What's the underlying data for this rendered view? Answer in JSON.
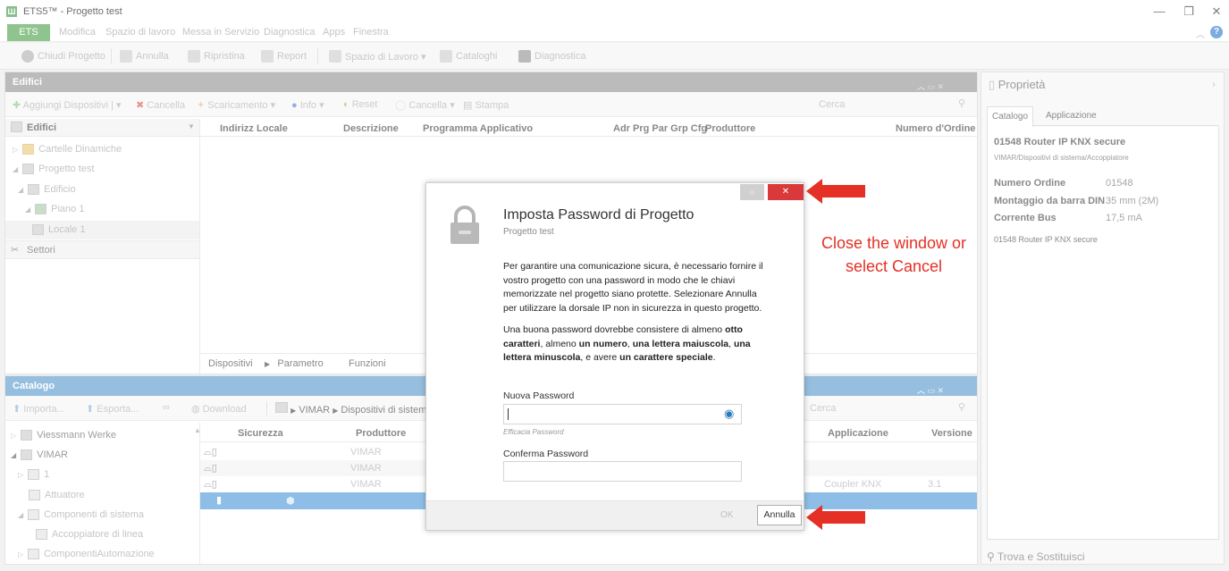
{
  "window": {
    "title": "ETS5™ - Progetto test",
    "controls": [
      "—",
      "❐",
      "✕"
    ]
  },
  "menubar": {
    "ets": "ETS",
    "items": [
      "Modifica",
      "Spazio di lavoro",
      "Messa in Servizio",
      "Diagnostica",
      "Apps",
      "Finestra"
    ]
  },
  "toolbar": {
    "items": [
      "Chiudi Progetto",
      "Annulla",
      "Ripristina",
      "Report",
      "Spazio di Lavoro ▾",
      "Cataloghi",
      "Diagnostica"
    ]
  },
  "buildings_panel": {
    "title": "Edifici",
    "subtoolbar": [
      "Aggiungi Dispositivi | ▾",
      "Cancella",
      "Scaricamento ▾",
      "Info ▾",
      "Reset",
      "Cancella ▾",
      "Stampa"
    ],
    "search_placeholder": "Cerca",
    "tree_header": "Edifici",
    "tree": [
      "Cartelle Dinamiche",
      "Progetto test",
      "Edificio",
      "Piano 1",
      "Locale 1",
      "Settori"
    ],
    "columns": [
      "Indirizz",
      "Locale",
      "Descrizione",
      "Programma Applicativo",
      "Adr Prg Par Grp Cfg",
      "Produttore",
      "Numero d'Ordine"
    ],
    "tabs": [
      "Dispositivi",
      "Parametro",
      "Funzioni"
    ]
  },
  "catalog_panel": {
    "title": "Catalogo",
    "subtoolbar": [
      "Importa...",
      "Esporta...",
      "Download"
    ],
    "breadcrumb": [
      "VIMAR",
      "Dispositivi di sistema"
    ],
    "search_placeholder": "Cerca",
    "tree": [
      "Viessmann Werke",
      "VIMAR",
      "1",
      "Attuatore",
      "Componenti di sistema",
      "Accoppiatore di linea",
      "ComponentiAutomazione"
    ],
    "columns": [
      "Sicurezza",
      "Produttore",
      "Applicazione",
      "Versione"
    ],
    "rows": [
      {
        "producer": "VIMAR",
        "application": "",
        "version": ""
      },
      {
        "producer": "VIMAR",
        "application": "",
        "version": ""
      },
      {
        "producer": "VIMAR",
        "application": "Coupler KNX",
        "version": "3.1"
      },
      {
        "producer": "",
        "application": "",
        "version": ""
      }
    ]
  },
  "properties_panel": {
    "title": "Proprietà",
    "tabs": [
      "Catalogo",
      "Applicazione"
    ],
    "product_title": "01548 Router IP KNX secure",
    "product_path": "VIMAR/Dispositivi di sistema/Accoppiatore",
    "fields": [
      {
        "label": "Numero Ordine",
        "value": "01548"
      },
      {
        "label": "Montaggio da barra DIN",
        "value": "35 mm (2M)"
      },
      {
        "label": "Corrente Bus",
        "value": "17,5 mA"
      }
    ],
    "description": "01548 Router IP KNX secure",
    "find_replace": "Trova e Sostituisci"
  },
  "dialog": {
    "title": "Imposta Password di Progetto",
    "subtitle": "Progetto test",
    "paragraph1": "Per garantire una comunicazione sicura, è necessario fornire il vostro progetto con una password in modo che le chiavi memorizzate nel progetto siano protette. Selezionare Annulla per utilizzare la dorsale IP non in sicurezza in questo progetto.",
    "p2_a": "Una buona password dovrebbe consistere di almeno ",
    "p2_b": "otto caratteri",
    "p2_c": ", almeno ",
    "p2_d": "un numero",
    "p2_e": ", ",
    "p2_f": "una lettera maiuscola",
    "p2_g": ", ",
    "p2_h": "una lettera minuscola",
    "p2_i": ", e avere ",
    "p2_j": "un carattere speciale",
    "p2_k": ".",
    "new_password_label": "Nuova Password",
    "new_password_value": "",
    "strength_label": "Efficacia Password",
    "confirm_password_label": "Conferma Password",
    "confirm_password_value": "",
    "ok_label": "OK",
    "cancel_label": "Annulla",
    "close_glyph": "✕",
    "help_glyph": "○"
  },
  "annotation": {
    "text_line1": "Close the window or",
    "text_line2": "select Cancel",
    "color": "#e53025"
  }
}
